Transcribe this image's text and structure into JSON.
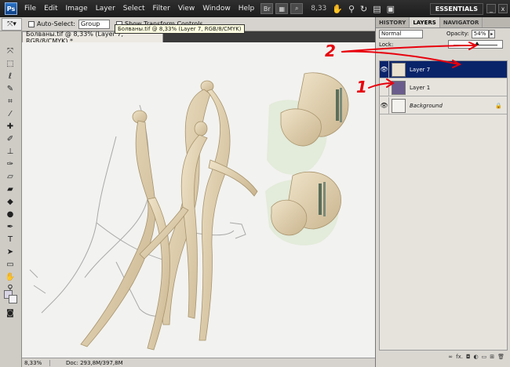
{
  "app": {
    "logo": "Ps"
  },
  "menu": [
    "File",
    "Edit",
    "Image",
    "Layer",
    "Select",
    "Filter",
    "View",
    "Window",
    "Help"
  ],
  "menubar": {
    "zoom": "8,33",
    "workspace": "ESSENTIALS",
    "bridge_label": "Br",
    "minimize": "_",
    "close": "x"
  },
  "options": {
    "auto_select_label": "Auto-Select:",
    "group_value": "Group",
    "show_transform_label": "Show Transform Controls"
  },
  "document": {
    "tab_title": "Болваны.tif @ 8,33% (Layer 7, RGB/8/CMYK) *",
    "tooltip": "Болваны.tif @ 8,33% (Layer 7, RGB/8/CMYK)"
  },
  "status": {
    "zoom": "8,33%",
    "doc": "Doc: 293,8M/397,8M"
  },
  "panel": {
    "tabs": [
      "HISTORY",
      "LAYERS",
      "NAVIGATOR"
    ],
    "active_tab": 1,
    "blend_mode": "Normal",
    "opacity_label": "Opacity:",
    "opacity_value": "54%",
    "opacity_fraction": 0.54,
    "lock_label": "Lock:",
    "bottom_icons": [
      "∞",
      "fx.",
      "◘",
      "◐",
      "▭",
      "⊞",
      "🗑"
    ]
  },
  "layers": [
    {
      "name": "Layer 7",
      "selected": true,
      "thumb_color": "#e9e0cf"
    },
    {
      "name": "Layer 1",
      "selected": false,
      "thumb_color": "#6a5c8c"
    },
    {
      "name": "Background",
      "selected": false,
      "thumb_color": "#f4f2ee",
      "locked": true
    }
  ],
  "annotations": {
    "label_1": "1",
    "label_2": "2",
    "color": "#e8000c"
  },
  "colors": {
    "selected_layer": "#0a246a",
    "foreground": "#d8d4e4"
  }
}
